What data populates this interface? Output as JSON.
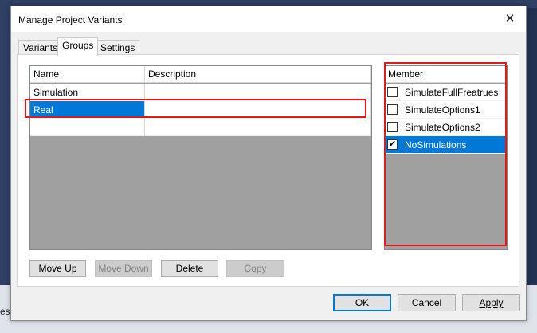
{
  "background": {
    "partial_text": "ess"
  },
  "dialog": {
    "title": "Manage Project Variants",
    "close_glyph": "✕"
  },
  "tabs": [
    {
      "label": "Variants",
      "active": false
    },
    {
      "label": "Groups",
      "active": true
    },
    {
      "label": "Settings",
      "active": false
    }
  ],
  "groups_table": {
    "columns": [
      "Name",
      "Description"
    ],
    "rows": [
      {
        "name": "Simulation",
        "description": ""
      },
      {
        "name": "Real",
        "description": "",
        "selected": true
      },
      {
        "name": "",
        "description": ""
      }
    ]
  },
  "member_list": {
    "header": "Member",
    "items": [
      {
        "label": "SimulateFullFreatrues",
        "checked": false
      },
      {
        "label": "SimulateOptions1",
        "checked": false
      },
      {
        "label": "SimulateOptions2",
        "checked": false
      },
      {
        "label": "NoSimulations",
        "checked": true,
        "selected": true
      }
    ],
    "check_glyph": "✔"
  },
  "group_buttons": {
    "move_up": "Move Up",
    "move_down": "Move Down",
    "delete": "Delete",
    "copy": "Copy"
  },
  "footer_buttons": {
    "ok": "OK",
    "cancel": "Cancel",
    "apply": "Apply"
  },
  "colors": {
    "selection": "#0078d7",
    "highlight": "#e01a1a",
    "empty_area": "#a0a0a0"
  }
}
